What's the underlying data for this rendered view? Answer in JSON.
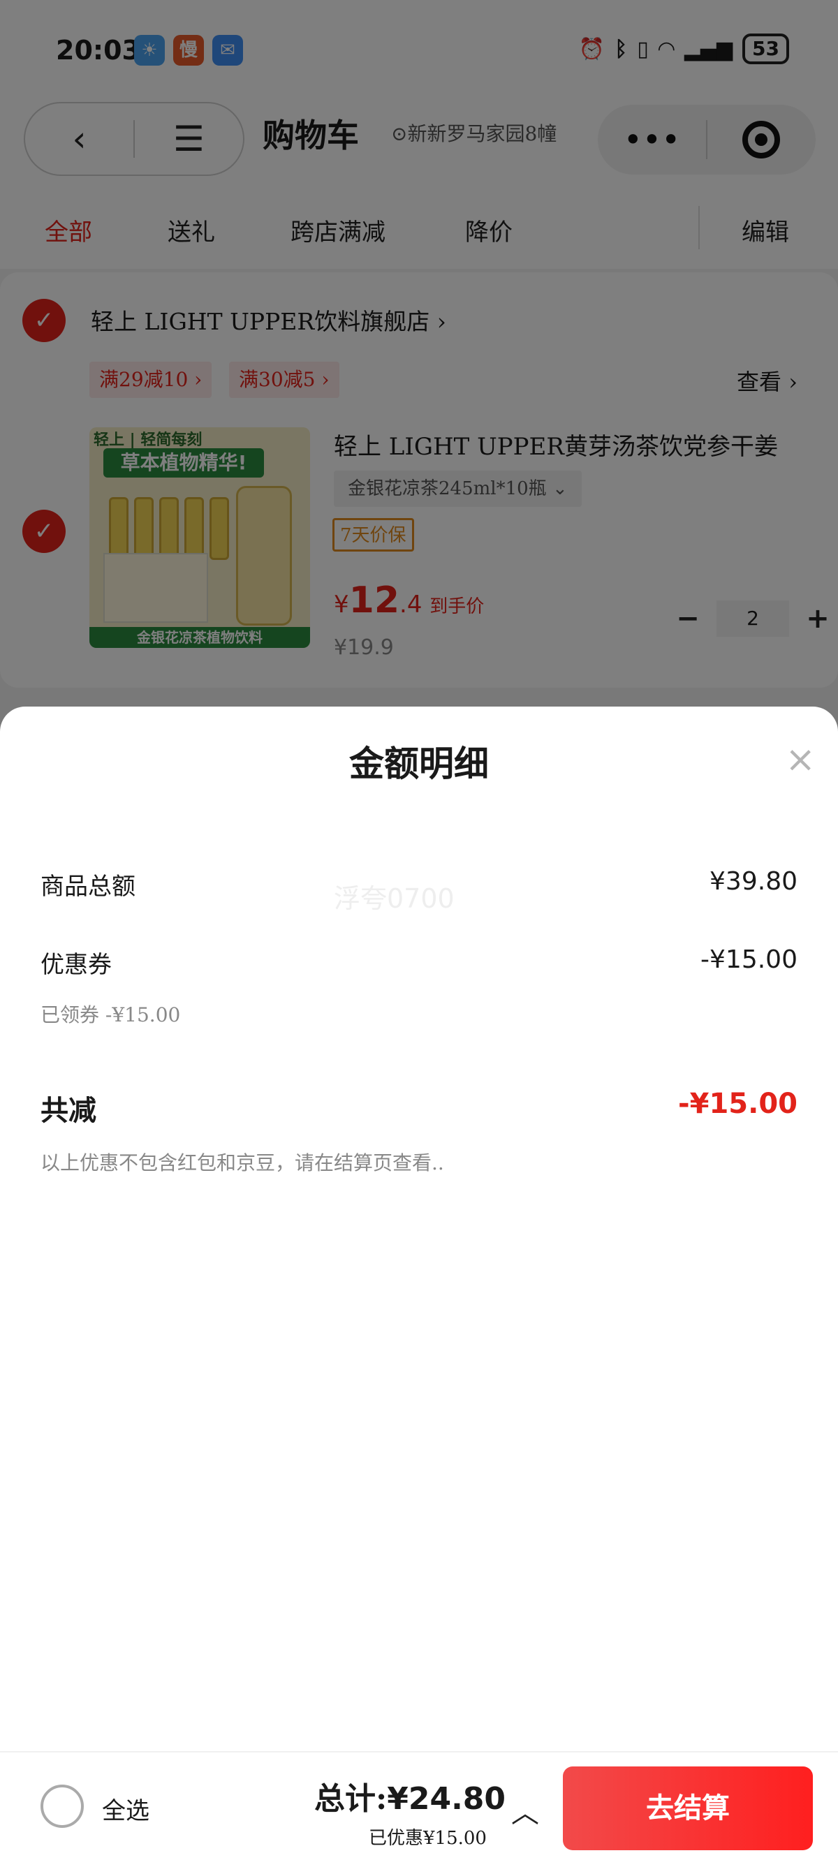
{
  "status_bar": {
    "time": "20:03",
    "app_badges": [
      "weather-icon",
      "慢",
      "message-icon"
    ],
    "battery": "53"
  },
  "nav": {
    "title": "购物车",
    "location": "新新罗马家园8幢"
  },
  "tabs": [
    "全部",
    "送礼",
    "跨店满减",
    "降价"
  ],
  "edit_label": "编辑",
  "shop": {
    "name": "轻上 LIGHT UPPER饮料旗舰店 ›",
    "promos": [
      "满29减10 ›",
      "满30减5 ›"
    ],
    "see_more": "查看 ›"
  },
  "product": {
    "image_top": "轻上 | 轻简每刻",
    "image_banner": "草本植物精华!",
    "image_footer": "金银花凉茶植物饮料",
    "title": "轻上 LIGHT UPPER黄芽汤茶饮党参干姜",
    "spec": "金银花凉茶245ml*10瓶 ⌄",
    "guarantee": "7天价保",
    "currency": "¥",
    "price_int": "12",
    "price_dec": ".4",
    "price_label": "到手价",
    "original_price": "¥19.9",
    "quantity": "2"
  },
  "sheet": {
    "title": "金额明细",
    "close": "×",
    "watermark": "浮夸0700",
    "rows": [
      {
        "label": "商品总额",
        "value": "¥39.80"
      },
      {
        "label": "优惠券",
        "value": "-¥15.00",
        "sub": "已领券 -¥15.00"
      }
    ],
    "total_reduce_label": "共减",
    "total_reduce_value": "-¥15.00",
    "note": "以上优惠不包含红包和京豆，请在结算页查看.."
  },
  "footer": {
    "select_all": "全选",
    "total_label": "总计:",
    "total_value": "¥24.80",
    "saved": "已优惠¥15.00",
    "checkout": "去结算"
  },
  "colors": {
    "accent": "#e2231a",
    "warn": "#e08a1e"
  }
}
